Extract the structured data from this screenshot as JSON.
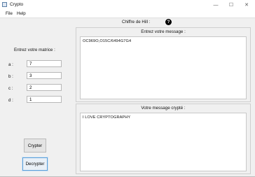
{
  "window": {
    "title": "Crypto",
    "min_glyph": "—",
    "max_glyph": "☐",
    "close_glyph": "✕"
  },
  "menu": {
    "items": [
      "File",
      "Help"
    ]
  },
  "header": {
    "label": "Chiffre de Hill :",
    "help_glyph": "?"
  },
  "matrix": {
    "label": "Entrez votre matrice :",
    "fields": [
      {
        "label": "a :",
        "value": "7"
      },
      {
        "label": "b :",
        "value": "3"
      },
      {
        "label": "c :",
        "value": "2"
      },
      {
        "label": "d :",
        "value": "1"
      }
    ]
  },
  "buttons": {
    "crypter": "Crypter",
    "decrypter": "Decrypter"
  },
  "input_panel": {
    "title": "Entrez votre message :",
    "text": "OC969O,O15C/6494G7G4"
  },
  "output_panel": {
    "title": "Votre message crypté :",
    "text": "I LOVE CRYPTOGRAPHY"
  }
}
